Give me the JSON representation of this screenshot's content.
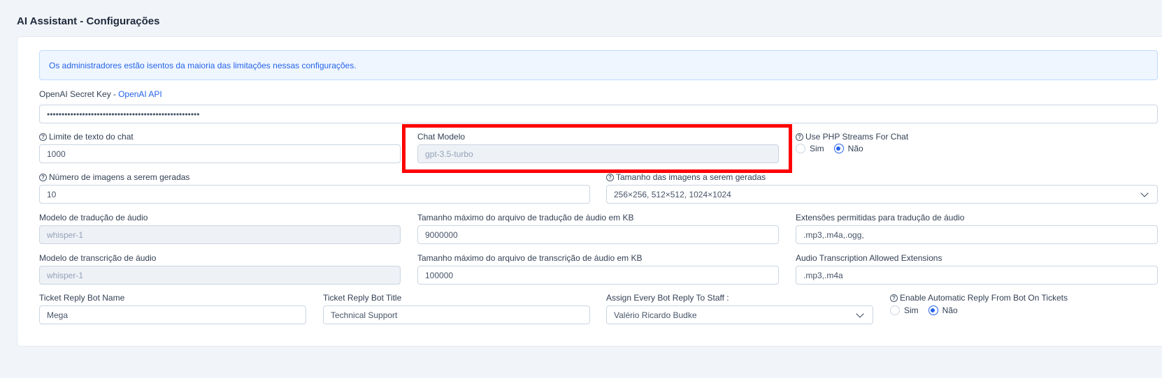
{
  "page": {
    "title": "AI Assistant - Configurações"
  },
  "alert": {
    "text": "Os administradores estão isentos da maioria das limitações nessas configurações."
  },
  "secret_key": {
    "label": "OpenAI Secret Key - ",
    "link": "OpenAI API",
    "value": "••••••••••••••••••••••••••••••••••••••••••••••••••••"
  },
  "chat_limit": {
    "label": "Limite de texto do chat",
    "value": "1000"
  },
  "chat_model": {
    "label": "Chat Modelo",
    "value": "gpt-3.5-turbo"
  },
  "php_streams": {
    "label": "Use PHP Streams For Chat",
    "options": [
      "Sim",
      "Não"
    ],
    "selected": "Não"
  },
  "num_images": {
    "label": "Número de imagens a serem geradas",
    "value": "10"
  },
  "image_size": {
    "label": "Tamanho das imagens a serem geradas",
    "value": "256×256, 512×512, 1024×1024"
  },
  "translation_model": {
    "label": "Modelo de tradução de áudio",
    "value": "whisper-1"
  },
  "translation_max": {
    "label": "Tamanho máximo do arquivo de tradução de áudio em KB",
    "value": "9000000"
  },
  "translation_ext": {
    "label": "Extensões permitidas para tradução de áudio",
    "value": ".mp3,.m4a,.ogg,"
  },
  "transcription_model": {
    "label": "Modelo de transcrição de áudio",
    "value": "whisper-1"
  },
  "transcription_max": {
    "label": "Tamanho máximo do arquivo de transcrição de áudio em KB",
    "value": "100000"
  },
  "transcription_ext": {
    "label": "Audio Transcription Allowed Extensions",
    "value": ".mp3,.m4a"
  },
  "bot_name": {
    "label": "Ticket Reply Bot Name",
    "value": "Mega"
  },
  "bot_title": {
    "label": "Ticket Reply Bot Title",
    "value": "Technical Support"
  },
  "assign_staff": {
    "label": "Assign Every Bot Reply To Staff :",
    "value": "Valério Ricardo Budke"
  },
  "auto_reply": {
    "label": "Enable Automatic Reply From Bot On Tickets",
    "options": [
      "Sim",
      "Não"
    ],
    "selected": "Não"
  },
  "icons": {
    "help": "help-circle-icon",
    "chevron": "chevron-down-icon"
  },
  "colors": {
    "accent": "#2563eb",
    "highlight": "#ff0000",
    "disabled_bg": "#eef1f6"
  }
}
